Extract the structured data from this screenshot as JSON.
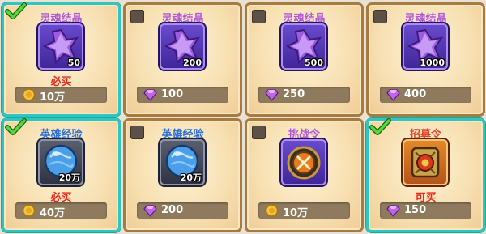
{
  "colors": {
    "selected_border": "#2fc6c0",
    "card_border": "#a77a3f",
    "status_red": "#e42d1f",
    "title_purple": "#b058d8",
    "title_blue": "#2c6fd5",
    "title_red": "#e0462a"
  },
  "cards": [
    {
      "title": "灵魂结晶",
      "qty": "50",
      "status": "必买",
      "price": "10万",
      "currency_icon": "gold-coin-icon",
      "selected": true,
      "item_icon": "soul-crystal-icon"
    },
    {
      "title": "灵魂结晶",
      "qty": "200",
      "status": "",
      "price": "100",
      "currency_icon": "purple-diamond-icon",
      "selected": false,
      "item_icon": "soul-crystal-icon"
    },
    {
      "title": "灵魂结晶",
      "qty": "500",
      "status": "",
      "price": "250",
      "currency_icon": "purple-diamond-icon",
      "selected": false,
      "item_icon": "soul-crystal-icon"
    },
    {
      "title": "灵魂结晶",
      "qty": "1000",
      "status": "",
      "price": "400",
      "currency_icon": "purple-diamond-icon",
      "selected": false,
      "item_icon": "soul-crystal-icon"
    },
    {
      "title": "英雄经验",
      "qty": "20万",
      "status": "必买",
      "price": "40万",
      "currency_icon": "gold-coin-icon",
      "selected": true,
      "item_icon": "hero-exp-orb-icon"
    },
    {
      "title": "英雄经验",
      "qty": "20万",
      "status": "",
      "price": "200",
      "currency_icon": "purple-diamond-icon",
      "selected": false,
      "item_icon": "hero-exp-orb-icon"
    },
    {
      "title": "挑战令",
      "qty": "",
      "status": "",
      "price": "10万",
      "currency_icon": "gold-coin-icon",
      "selected": false,
      "item_icon": "challenge-token-icon"
    },
    {
      "title": "招募令",
      "qty": "",
      "status": "可买",
      "price": "150",
      "currency_icon": "purple-diamond-icon",
      "selected": true,
      "item_icon": "recruit-token-icon"
    }
  ]
}
